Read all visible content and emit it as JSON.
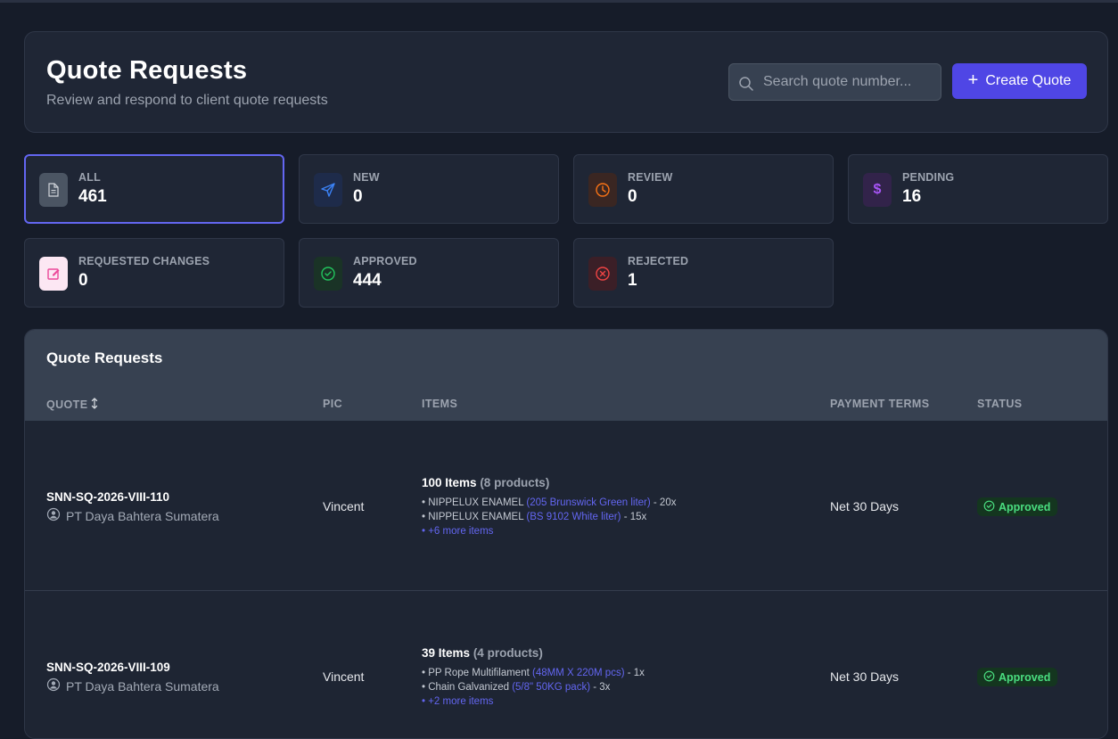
{
  "header": {
    "title": "Quote Requests",
    "subtitle": "Review and respond to client quote requests",
    "search_placeholder": "Search quote number...",
    "create_label": "Create Quote"
  },
  "stats": [
    {
      "label": "ALL",
      "value": "461",
      "icon": "document-icon",
      "color": "#9ca3af"
    },
    {
      "label": "NEW",
      "value": "0",
      "icon": "send-icon",
      "color": "#3b82f6"
    },
    {
      "label": "REVIEW",
      "value": "0",
      "icon": "clock-icon",
      "color": "#f97316"
    },
    {
      "label": "PENDING",
      "value": "16",
      "icon": "dollar-icon",
      "color": "#a855f7"
    },
    {
      "label": "REQUESTED CHANGES",
      "value": "0",
      "icon": "edit-icon",
      "color": "#ec4899"
    },
    {
      "label": "APPROVED",
      "value": "444",
      "icon": "check-circle-icon",
      "color": "#22c55e"
    },
    {
      "label": "REJECTED",
      "value": "1",
      "icon": "x-circle-icon",
      "color": "#ef4444"
    }
  ],
  "table": {
    "title": "Quote Requests",
    "columns": [
      "QUOTE",
      "PIC",
      "ITEMS",
      "PAYMENT TERMS",
      "STATUS"
    ],
    "rows": [
      {
        "quote": "SNN-SQ-2026-VIII-110",
        "client": "PT Daya Bahtera Sumatera",
        "pic": "Vincent",
        "items_count": "100 Items",
        "products": "(8 products)",
        "lines": [
          {
            "name": "• NIPPELUX ENAMEL",
            "spec": "(205 Brunswick Green liter)",
            "qty": "- 20x"
          },
          {
            "name": "• NIPPELUX ENAMEL",
            "spec": "(BS 9102 White liter)",
            "qty": "- 15x"
          }
        ],
        "more": "• +6 more items",
        "terms": "Net 30 Days",
        "status": "Approved"
      },
      {
        "quote": "SNN-SQ-2026-VIII-109",
        "client": "PT Daya Bahtera Sumatera",
        "pic": "Vincent",
        "items_count": "39 Items",
        "products": "(4 products)",
        "lines": [
          {
            "name": "• PP Rope Multifilament",
            "spec": "(48MM X 220M pcs)",
            "qty": "- 1x"
          },
          {
            "name": "• Chain Galvanized",
            "spec": "(5/8\" 50KG pack)",
            "qty": "- 3x"
          }
        ],
        "more": "• +2 more items",
        "terms": "Net 30 Days",
        "status": "Approved"
      }
    ]
  }
}
